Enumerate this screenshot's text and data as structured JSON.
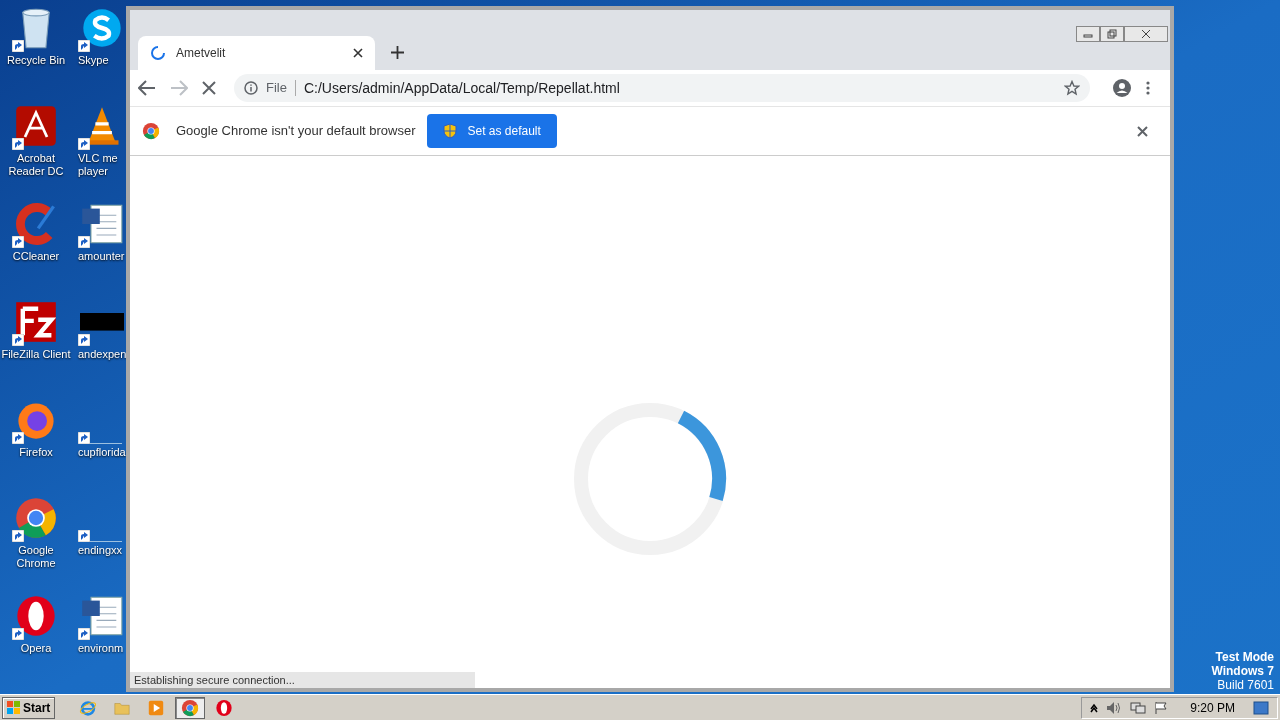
{
  "desktop": {
    "icons": [
      {
        "kind": "recycle",
        "lines": [
          "Recycle Bin"
        ]
      },
      {
        "kind": "acrobat",
        "lines": [
          "Acrobat",
          "Reader DC"
        ]
      },
      {
        "kind": "ccleaner",
        "lines": [
          "CCleaner"
        ]
      },
      {
        "kind": "filezilla",
        "lines": [
          "FileZilla Client"
        ]
      },
      {
        "kind": "firefox",
        "lines": [
          "Firefox"
        ]
      },
      {
        "kind": "chrome",
        "lines": [
          "Google",
          "Chrome"
        ]
      },
      {
        "kind": "opera",
        "lines": [
          "Opera"
        ]
      }
    ],
    "partly_hidden_icons": [
      {
        "kind": "skype",
        "lines": [
          "Skype"
        ]
      },
      {
        "kind": "vlc",
        "lines": [
          "VLC me",
          "player"
        ]
      },
      {
        "kind": "word",
        "lines": [
          "amounter"
        ]
      },
      {
        "kind": "black",
        "lines": [
          "andexpen"
        ]
      },
      {
        "kind": "blank",
        "lines": [
          "cupflorida"
        ]
      },
      {
        "kind": "blank",
        "lines": [
          "endingxx"
        ]
      },
      {
        "kind": "word",
        "lines": [
          "environm"
        ]
      }
    ]
  },
  "browser": {
    "tab": {
      "title": "Ametvelit",
      "loading": true
    },
    "forward_enabled": false,
    "address": {
      "scheme": "File",
      "url": "C:/Users/admin/AppData/Local/Temp/Repellat.html"
    },
    "infobar": {
      "message": "Google Chrome isn't your default browser",
      "button": "Set as default"
    },
    "status": "Establishing secure connection..."
  },
  "system_notice": [
    "Test Mode",
    "Windows 7",
    "Build 7601"
  ],
  "taskbar": {
    "start": "Start",
    "apps": [
      {
        "kind": "ie",
        "selected": false
      },
      {
        "kind": "folder",
        "selected": false
      },
      {
        "kind": "media",
        "selected": false
      },
      {
        "kind": "chrome",
        "selected": true
      },
      {
        "kind": "opera",
        "selected": false
      }
    ],
    "time": "9:20 PM"
  }
}
